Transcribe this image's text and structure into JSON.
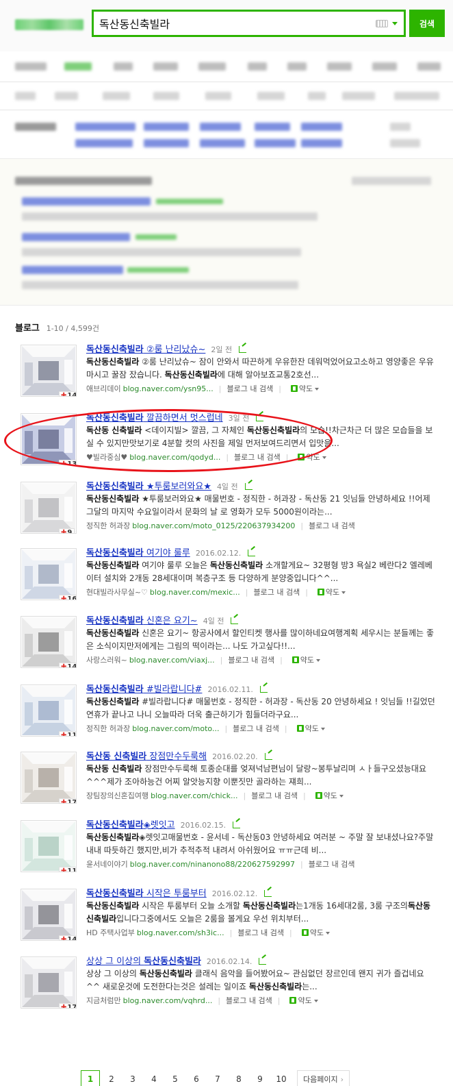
{
  "search": {
    "query": "독산동신축빌라",
    "button_label": "검색"
  },
  "colors": {
    "brand_green": "#2db400",
    "link_blue": "#1733c3",
    "highlight_red": "#e8131a"
  },
  "blog": {
    "section_title": "블로그",
    "count_text": "1-10 / 4,599건",
    "items": [
      {
        "title": "독산동신축빌라 ②룸 난리났슈~",
        "date": "2일 전",
        "desc": "독산동신축빌라 ②룸 난리났슈~ 잠이 안와서 따끈하게 우유한잔 데워먹었어요고소하고 영양좋은 우유마시고 꿀잠 잤습니다. 독산동신축빌라에 대해 알아보죠교통2호선...",
        "author": "애브리데이",
        "url": "blog.naver.com/ysn95...",
        "inner": "블로그 내 검색",
        "map": "약도",
        "badge": "14"
      },
      {
        "title": "독산동신축빌라 깔끔하면서 멋스럽네",
        "date": "3일 전",
        "desc": "독산동 신축빌라 <데이지빌> 깔끔, 그 자체인 독산동신축빌라의 모습!!차근차근 더 많은 모습들을 보실 수 있지만맛보기로 4분할 컷의 사진을 제일 먼저보여드리면서 입맛을...",
        "author": "♥빌라중심♥",
        "url": "blog.naver.com/qodyd...",
        "inner": "블로그 내 검색",
        "map": "약도",
        "badge": "13"
      },
      {
        "title": "독산동신축빌라 ★투룸보러와요★",
        "date": "4일 전",
        "desc": "독산동신축빌라 ★투룸보러와요★ 매물번호 - 정직한 - 허과장 - 독산동 21 잇님들 안녕하세요 !!어제 그달의 마지막 수요일이라서 문화의 날 로 영화가 모두 5000원이라는...",
        "author": "정직한 허과장",
        "url": "blog.naver.com/moto_0125/220637934200",
        "inner": "블로그 내 검색",
        "map": "",
        "badge": "9"
      },
      {
        "title": "독산동신축빌라 여기야 룰루",
        "date": "2016.02.12.",
        "desc": "독산동신축빌라 여기야 룰루 오늘은 독산동신축빌라 소개할게요~ 32평형 방3 욕실2 베란다2 엘레베이터 설치와 2개동 28세대이며 복층구조 등 다양하게 분양중입니다^^...",
        "author": "현대빌라사무실~♡",
        "url": "blog.naver.com/mexic...",
        "inner": "블로그 내 검색",
        "map": "약도",
        "badge": "16"
      },
      {
        "title": "독산동신축빌라 신혼은 요기~",
        "date": "4일 전",
        "desc": "독산동신축빌라 신혼은 요기~ 항공사에서 할인티켓 행사를 많이하네요여행계획 세우시는 분들께는 좋은 소식이지만저에게는 그림의 떡이라는... 나도 가고싶다!!...",
        "author": "사랑스러워~",
        "url": "blog.naver.com/viaxj...",
        "inner": "블로그 내 검색",
        "map": "약도",
        "badge": "14"
      },
      {
        "title": "독산동신축빌라 #빌라랍니다#",
        "date": "2016.02.11.",
        "desc": "독산동신축빌라 #빌라랍니다# 매물번호 - 정직한 - 허과장 - 독산동 20 안녕하세요 ! 잇님들 !!길었던 연휴가 끝나고 나니 오늘따라 더욱 출근하기가 힘들더라구요...",
        "author": "정직한 허과장",
        "url": "blog.naver.com/moto...",
        "inner": "블로그 내 검색",
        "map": "약도",
        "badge": "11"
      },
      {
        "title": "독산동 신축빌라 장점만수두룩해",
        "date": "2016.02.20.",
        "desc": "독산동 신축빌라 장점만수두룩해 토종순대를 엊져넉남편님이 달랑~봉투날리며 ㅅㅏ들구오셨능대요^^^제가 조아하능건 어찌 알앗능지향 이뿐짓만 골라하는 쟤희...",
        "author": "장팀장의신혼집여행",
        "url": "blog.naver.com/chick...",
        "inner": "블로그 내 검색",
        "map": "약도",
        "badge": "17"
      },
      {
        "title": "독산동신축빌라◈렛잇고",
        "date": "2016.02.15.",
        "desc": "독산동신축빌라◈렛잇고매물번호 - 윤서네 - 독산동03 안녕하세요 여러분 ~ 주말 잘 보내셨나요?주말내내 따듯하긴 했지만,비가 추적추적 내려서 아쉬웠어요 ㅠㅠ근데 비...",
        "author": "윤서네이야기",
        "url": "blog.naver.com/ninanono88/220627592997",
        "inner": "블로그 내 검색",
        "map": "",
        "badge": "11"
      },
      {
        "title": "독산동신축빌라 시작은 투룸부터",
        "date": "2016.02.12.",
        "desc": "독산동신축빌라 시작은 투룸부터 오늘 소개할 독산동신축빌라는1개동 16세대2룸, 3룸 구조의독산동신축빌라입니다그중에서도 오늘은 2룸을 볼게요 우선 위치부터...",
        "author": "HD 주택사업부",
        "url": "blog.naver.com/sh3ic...",
        "inner": "블로그 내 검색",
        "map": "약도",
        "badge": "14"
      },
      {
        "title": "상상 그 이상의 독산동신축빌라",
        "date": "2016.02.14.",
        "desc": "상상 그 이상의 독산동신축빌라 클래식 음악을 들어봤어요~ 관심없던 장르인데 왠지 귀가 즐겁네요 ^^ 새로운것에 도전한다는것은 설레는 일이죠 독산동신축빌라는...",
        "author": "지금처럼만",
        "url": "blog.naver.com/vqhrd...",
        "inner": "블로그 내 검색",
        "map": "약도",
        "badge": "17"
      }
    ]
  },
  "pagination": {
    "current": "1",
    "pages": [
      "1",
      "2",
      "3",
      "4",
      "5",
      "6",
      "7",
      "8",
      "9",
      "10"
    ],
    "next_label": "다음페이지"
  }
}
